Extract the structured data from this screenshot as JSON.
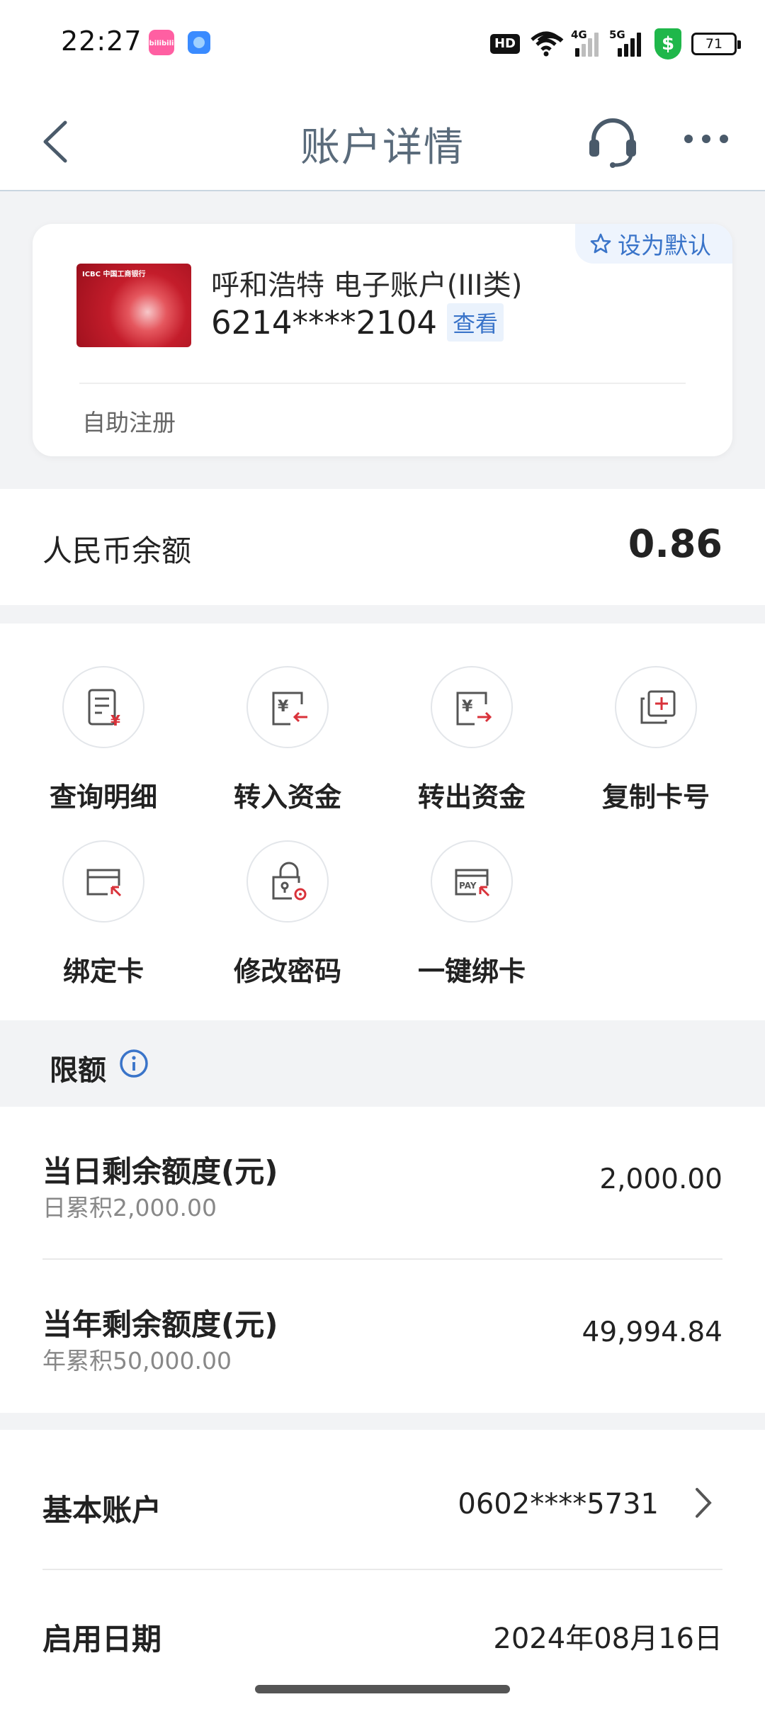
{
  "status_bar": {
    "time": "22:27",
    "app1_label": "bilibili",
    "hd": "HD",
    "net1": "4G",
    "net2": "5G",
    "battery": "71"
  },
  "nav": {
    "title": "账户详情"
  },
  "card": {
    "default_label": "设为默认",
    "name": "呼和浩特 电子账户(III类)",
    "number": "6214****2104",
    "view_label": "查看",
    "footer": "自助注册",
    "thumb_brand": "ICBC 中国工商银行"
  },
  "balance": {
    "label": "人民币余额",
    "amount": "0.86"
  },
  "actions": [
    {
      "label": "查询明细",
      "icon": "statement-icon"
    },
    {
      "label": "转入资金",
      "icon": "transfer-in-icon"
    },
    {
      "label": "转出资金",
      "icon": "transfer-out-icon"
    },
    {
      "label": "复制卡号",
      "icon": "copy-icon"
    },
    {
      "label": "绑定卡",
      "icon": "bind-card-icon"
    },
    {
      "label": "修改密码",
      "icon": "password-lock-icon"
    },
    {
      "label": "一键绑卡",
      "icon": "pay-card-icon"
    }
  ],
  "limits": {
    "header": "限额",
    "rows": [
      {
        "title": "当日剩余额度(元)",
        "sub": "日累积2,000.00",
        "value": "2,000.00"
      },
      {
        "title": "当年剩余额度(元)",
        "sub": "年累积50,000.00",
        "value": "49,994.84"
      }
    ]
  },
  "info": {
    "rows": [
      {
        "key": "基本账户",
        "value": "0602****5731"
      },
      {
        "key": "启用日期",
        "value": "2024年08月16日"
      }
    ]
  },
  "colors": {
    "accent_blue": "#3a74c9",
    "icon_red": "#d9323a",
    "title_gray": "#5a6b7b"
  }
}
